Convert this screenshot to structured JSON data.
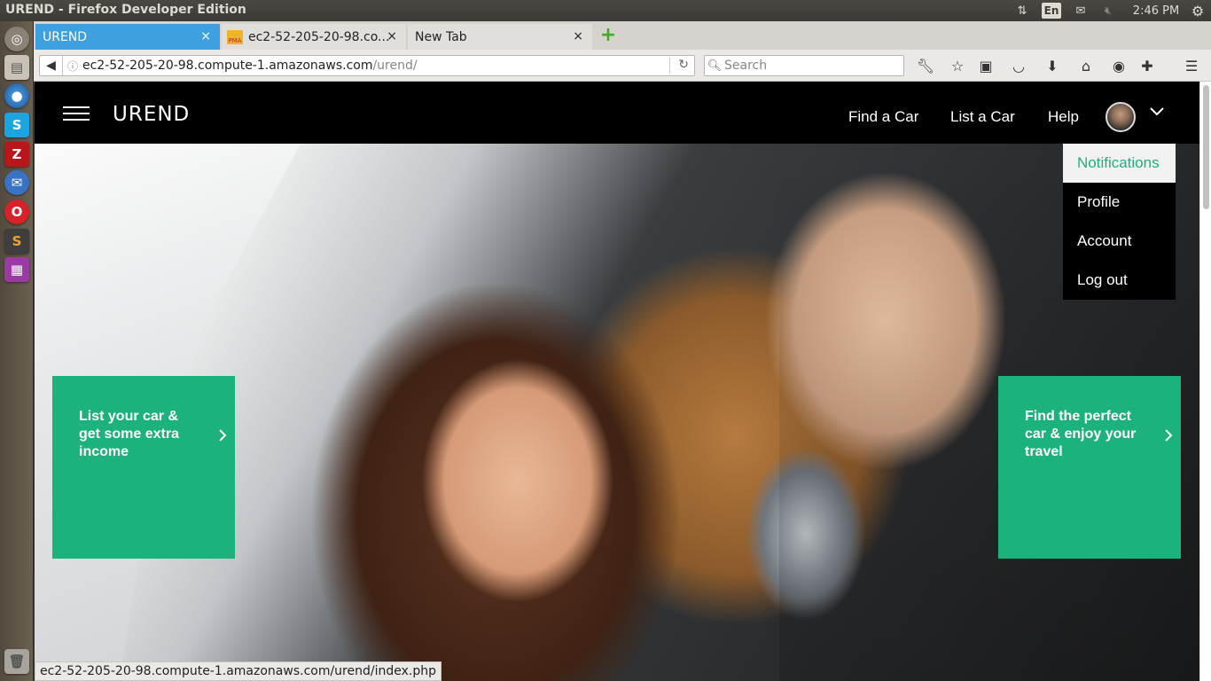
{
  "os": {
    "window_title": "UREND - Firefox Developer Edition",
    "keyboard_layout": "En",
    "time": "2:46 PM"
  },
  "browser": {
    "tabs": [
      {
        "label": "UREND",
        "active": true
      },
      {
        "label": "ec2-52-205-20-98.co...",
        "active": false,
        "favicon_text": "PMA"
      },
      {
        "label": "New Tab",
        "active": false
      }
    ],
    "tab_close_glyph": "×",
    "new_tab_glyph": "+",
    "url_host": "ec2-52-205-20-98.compute-1.amazonaws.com",
    "url_path": "/urend/",
    "search_placeholder": "Search",
    "status_tip": "ec2-52-205-20-98.compute-1.amazonaws.com/urend/index.php"
  },
  "site": {
    "logo": "UREND",
    "nav": {
      "find": "Find a Car",
      "list": "List a Car",
      "help": "Help"
    },
    "user_menu": [
      {
        "label": "Notifications",
        "active": true
      },
      {
        "label": "Profile",
        "active": false
      },
      {
        "label": "Account",
        "active": false
      },
      {
        "label": "Log out",
        "active": false
      }
    ],
    "cta_left": "List your car & get some extra income",
    "cta_right": "Find the perfect car & enjoy your travel",
    "accent_color": "#1bb27b"
  },
  "icons": {
    "launcher": [
      "dash-icon",
      "files-icon",
      "firefox-icon",
      "skype-icon",
      "filezilla-icon",
      "thunderbird-icon",
      "opera-icon",
      "sublime-icon",
      "gallery-icon",
      "trash-icon"
    ],
    "toolbar": [
      "wrench-icon",
      "star-icon",
      "clipboard-icon",
      "pocket-icon",
      "download-icon",
      "home-icon",
      "palette-icon",
      "puzzle-icon",
      "hamburger-menu-icon"
    ]
  }
}
